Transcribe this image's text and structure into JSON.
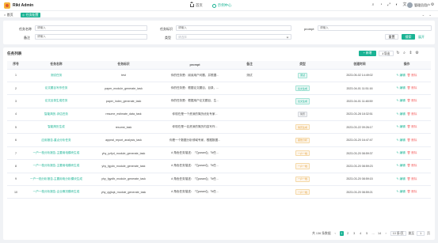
{
  "app": {
    "title": "Rikt Admin"
  },
  "topnav": {
    "home": "首页",
    "current": "示例中心"
  },
  "user": {
    "name": "管理员用户"
  },
  "tabs": [
    {
      "label": "首页"
    },
    {
      "label": "任务配置"
    }
  ],
  "search": {
    "task_name_label": "任务名称",
    "task_name_placeholder": "请输入",
    "task_code_label": "任务标识",
    "task_code_placeholder": "请输入",
    "prompt_label": "prompt",
    "prompt_placeholder": "请输入",
    "remark_label": "备注",
    "remark_placeholder": "请输入",
    "type_label": "类型",
    "type_placeholder": "请选择",
    "reset_label": "重置",
    "search_label": "搜索",
    "expand_label": "展开"
  },
  "list": {
    "title": "任务列表",
    "add_label": "新增",
    "export_label": "导出",
    "columns": [
      "序号",
      "任务名称",
      "任务标识",
      "prompt",
      "备注",
      "类型",
      "创建时间",
      "操作"
    ],
    "edit_label": "编辑",
    "delete_label": "删除",
    "rows": [
      {
        "no": "1",
        "name": "测试任务",
        "code": "test",
        "prompt": "你的任务是：阅读用户问题，并根据...",
        "remark": "测试",
        "type": "测试",
        "badge": "green",
        "time": "2023-05-02 14:49:02"
      },
      {
        "no": "2",
        "name": "论文题目写作任务",
        "code": "paper_module_generate_task",
        "prompt": "你的任务是：根据论文题目、目录、...",
        "remark": "",
        "type": "论文生成",
        "badge": "green",
        "time": "2023-04-01 11:51:16"
      },
      {
        "no": "3",
        "name": "论文目录生成任务",
        "code": "paper_index_generate_task",
        "prompt": "你的任务是：根据用户论文题目，生...",
        "remark": "",
        "type": "论文生成",
        "badge": "green",
        "time": "2023-04-01 11:48:59"
      },
      {
        "no": "4",
        "name": "智能简历-评估任务",
        "code": "resume_estimate_data_task",
        "prompt": "你现在是一个资深的简历优化专家...",
        "remark": "",
        "type": "简历",
        "badge": "grey",
        "time": "2023-03-28 18:32:51"
      },
      {
        "no": "5",
        "name": "智能简历生成",
        "code": "resume_task",
        "prompt": "你现在是一名资深的简历内容写作...",
        "remark": "",
        "type": "简历生成",
        "badge": "orange",
        "time": "2023-03-22 09:26:17"
      },
      {
        "no": "6",
        "name": "应用报告-重点分析任务",
        "code": "appeal_report_analysis_task",
        "prompt": "你是一个数据分析领域专家，根据数据...",
        "remark": "",
        "type": "报告分析",
        "badge": "orange",
        "time": "2023-03-20 16:47:47"
      },
      {
        "no": "7",
        "name": "一户一档分析报告-主要用电模块生成",
        "code": "yhy_yzfyd_module_generate_task",
        "prompt": "# 角色任务描述：「【param】」「#任...",
        "remark": "",
        "type": "一户一档",
        "badge": "orange",
        "time": "2023-03-20 08:59:37"
      },
      {
        "no": "8",
        "name": "一户一档分析报告-主要用电模块生成",
        "code": "yhy_fgydn_module_generate_task",
        "prompt": "# 角色任务描述：「【param】」「#任...",
        "remark": "",
        "type": "一户一档",
        "badge": "orange",
        "time": "2023-03-20 08:59:23"
      },
      {
        "no": "9",
        "name": "一户一档分析报告-主要用电分析模块生成",
        "code": "yhy_fgydfx_module_generate_task",
        "prompt": "# 角色任务描述：「【param】」「#任...",
        "remark": "",
        "type": "一户一档",
        "badge": "orange",
        "time": "2023-03-20 08:59:15"
      },
      {
        "no": "10",
        "name": "一户一档分析报告-企业概况模块生成",
        "code": "yhy_qyjkqk_module_generate_task",
        "prompt": "# 角色任务描述：「【param】」「#任...",
        "remark": "",
        "type": "一户一档",
        "badge": "orange",
        "time": "2023-03-20 08:59:21"
      }
    ]
  },
  "pager": {
    "total": "共 136 条数据",
    "pages": [
      "1",
      "2",
      "3",
      "4",
      "5",
      "...",
      "14"
    ],
    "active_page": "1",
    "size": "10 条/页",
    "jump_label": "跳至",
    "jump_value": "1",
    "page_unit": "页"
  },
  "colors": {
    "accent": "#1ab394",
    "danger": "#f56c6c",
    "warning": "#e6a23c"
  },
  "icons": [
    "logo-icon",
    "home-icon",
    "circle-icon",
    "search-icon",
    "bell-icon",
    "fullscreen-icon",
    "settings-icon",
    "refresh-icon",
    "column-icon"
  ]
}
